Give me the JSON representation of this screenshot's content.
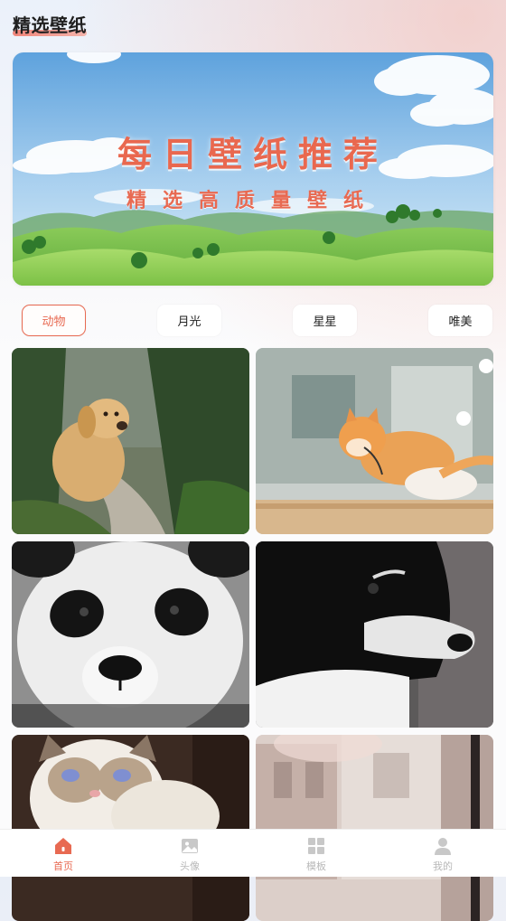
{
  "header": {
    "title": "精选壁纸"
  },
  "banner": {
    "title": "每日壁纸推荐",
    "subtitle": "精选高质量壁纸"
  },
  "categories": {
    "active_index": 0,
    "items": [
      {
        "label": "动物"
      },
      {
        "label": "月光"
      },
      {
        "label": "星星"
      },
      {
        "label": "唯美"
      }
    ]
  },
  "grid": {
    "items": [
      {
        "icon": "golden-retriever-image"
      },
      {
        "icon": "kitten-image"
      },
      {
        "icon": "panda-image"
      },
      {
        "icon": "border-collie-image"
      },
      {
        "icon": "ragdoll-cat-image"
      },
      {
        "icon": "blurred-street-image"
      }
    ]
  },
  "bottom_nav": {
    "active_index": 0,
    "items": [
      {
        "label": "首页",
        "icon": "home-icon"
      },
      {
        "label": "头像",
        "icon": "image-icon"
      },
      {
        "label": "模板",
        "icon": "grid-icon"
      },
      {
        "label": "我的",
        "icon": "user-icon"
      }
    ]
  },
  "colors": {
    "accent": "#e86a52",
    "inactive": "#b8b8b8"
  }
}
